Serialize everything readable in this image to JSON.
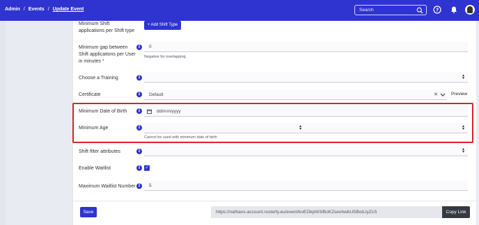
{
  "breadcrumb": {
    "items": [
      "Admin",
      "Events"
    ],
    "current": "Update Event",
    "separator": "/"
  },
  "search": {
    "placeholder": "Search"
  },
  "form": {
    "shift_applications": {
      "label": "Minimum Shift applications per Shift type",
      "button": "+ Add Shift Type"
    },
    "min_gap": {
      "label": "Minimum gap between Shift applicaitons per User in minutes",
      "required_mark": "*",
      "value": "0",
      "help": "Negative for overlapping"
    },
    "training": {
      "label": "Choose a Training",
      "value": ""
    },
    "certificate": {
      "label": "Certificate",
      "value": "Default",
      "clear": "✕",
      "preview": "Preview"
    },
    "min_dob": {
      "label": "Minimum Date of Birth",
      "placeholder": "dd/mm/yyyy"
    },
    "min_age": {
      "label": "Minimum Age",
      "help": "Cannot be used with minimum date of birth"
    },
    "shift_filter": {
      "label": "Shift filter attributes"
    },
    "waitlist": {
      "label": "Enable Waitlist",
      "checked": true
    },
    "max_waitlist": {
      "label": "Maximum Waitlist Number",
      "value": "5"
    }
  },
  "footer": {
    "save": "Save",
    "url": "https://nathans-account.rosterfy.eu/event/koEOkpW3/BoKZseohwbUSBotLtyZcS",
    "copy": "Copy Link"
  },
  "icons": {
    "info": "i",
    "check": "✓",
    "calendar": "calendar-icon"
  },
  "colors": {
    "primary": "#2f33cf",
    "highlight": "#d7222e",
    "dark_button": "#343a40"
  }
}
